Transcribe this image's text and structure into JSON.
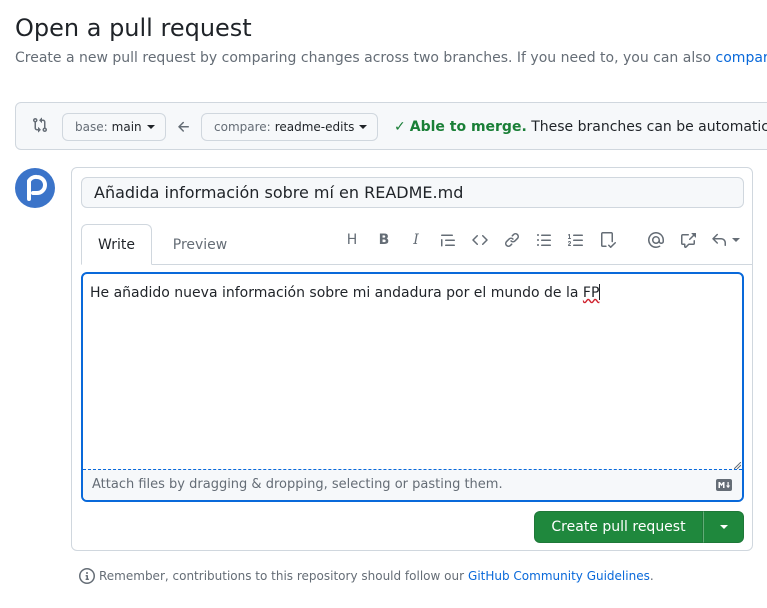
{
  "page": {
    "title": "Open a pull request",
    "subtitle": "Create a new pull request by comparing changes across two branches. If you need to, you can also",
    "subtitle_link": "compar"
  },
  "range": {
    "base_label": "base:",
    "base_value": "main",
    "compare_label": "compare:",
    "compare_value": "readme-edits",
    "merge_ok": "Able to merge.",
    "merge_rest": "These branches can be automatic"
  },
  "form": {
    "title_value": "Añadida información sobre mí en README.md",
    "tabs": [
      "Write",
      "Preview"
    ],
    "body_text": "He añadido nueva información sobre mi andadura por el mundo de la ",
    "body_text_flagged": "FP",
    "attach_hint": "Attach files by dragging & dropping, selecting or pasting them.",
    "toolbar": {
      "heading": "H",
      "bold": "B",
      "italic": "I"
    },
    "submit_label": "Create pull request"
  },
  "footer": {
    "remember": "Remember, contributions to this repository should follow our",
    "link": "GitHub Community Guidelines",
    "period": "."
  },
  "colors": {
    "accent": "#0969da",
    "success": "#1a7f37",
    "button": "#1f883d"
  }
}
